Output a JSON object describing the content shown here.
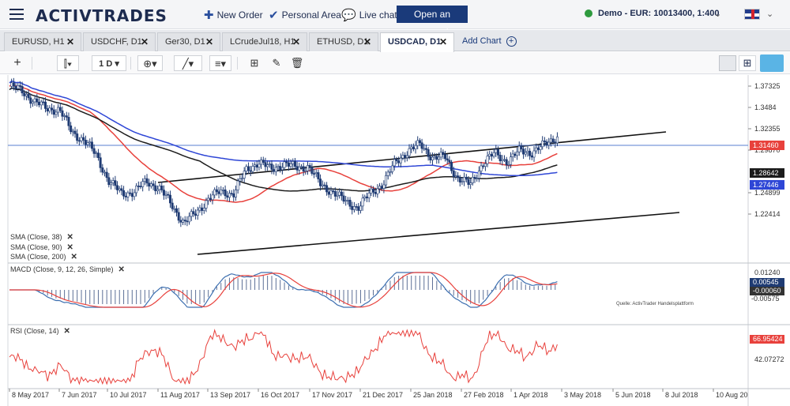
{
  "header": {
    "logo": "ACTIVTRADES",
    "new_order": "New Order",
    "personal_area": "Personal Area",
    "live_chat": "Live chat",
    "open_account": "Open an account",
    "account": "Demo - EUR: 10013400, 1:400"
  },
  "tabs": [
    {
      "label": "EURUSD, H1",
      "close": "✕"
    },
    {
      "label": "USDCHF, D1",
      "close": "✕"
    },
    {
      "label": "Ger30, D1",
      "close": "✕"
    },
    {
      "label": "LCrudeJul18, H1",
      "close": "✕"
    },
    {
      "label": "ETHUSD, D1",
      "close": "✕"
    },
    {
      "label": "USDCAD, D1",
      "close": "✕"
    }
  ],
  "add_chart": "Add Chart",
  "toolbar": {
    "period": "1 D"
  },
  "colors": {
    "sma38": "#e8413c",
    "sma90": "#1c1c1c",
    "sma200": "#2e46d6",
    "candle": "#1f3b73",
    "macd": "#3d6fb0",
    "signal": "#e8413c",
    "rsi": "#e8413c"
  },
  "legend": {
    "sma38": "SMA (Close, 38)",
    "sma90": "SMA (Close, 90)",
    "sma200": "SMA (Close, 200)",
    "macd": "MACD (Close, 9, 12, 26, Simple)",
    "rsi": "RSI (Close, 14)",
    "close": "✕",
    "source": "Quelle: ActivTrader Handelsplattform"
  },
  "chart_data": {
    "type": "candlestick",
    "symbol": "USDCAD, D1",
    "price_axis": [
      1.37325,
      1.3484,
      1.32355,
      1.2987,
      1.24899,
      1.22414
    ],
    "price_tags": [
      {
        "value": "1.31460",
        "color": "#e8413c"
      },
      {
        "value": "1.28642",
        "color": "#1c1c1c"
      },
      {
        "value": "1.27446",
        "color": "#2e46d6"
      }
    ],
    "horizontal_level": 1.3146,
    "macd_axis": [
      "0.01240",
      "-0.00575"
    ],
    "macd_tags": [
      {
        "value": "0.00545",
        "color": "#1f3b73"
      },
      {
        "value": "-0.00060",
        "color": "#ffffff"
      }
    ],
    "rsi_axis": [
      "42.07272"
    ],
    "rsi_tags": [
      {
        "value": "66.95424",
        "color": "#e8413c"
      }
    ],
    "x_labels": [
      "8 May 2017",
      "7 Jun 2017",
      "10 Jul 2017",
      "11 Aug 2017",
      "13 Sep 2017",
      "16 Oct 2017",
      "17 Nov 2017",
      "21 Dec 2017",
      "25 Jan 2018",
      "27 Feb 2018",
      "1 Apr 2018",
      "3 May 2018",
      "5 Jun 2018",
      "8 Jul 2018",
      "10 Aug 20"
    ],
    "close_series": [
      {
        "x": 0.0,
        "y": 1.373
      },
      {
        "x": 0.02,
        "y": 1.368
      },
      {
        "x": 0.04,
        "y": 1.355
      },
      {
        "x": 0.06,
        "y": 1.347
      },
      {
        "x": 0.08,
        "y": 1.346
      },
      {
        "x": 0.1,
        "y": 1.32
      },
      {
        "x": 0.12,
        "y": 1.31
      },
      {
        "x": 0.14,
        "y": 1.292
      },
      {
        "x": 0.16,
        "y": 1.262
      },
      {
        "x": 0.18,
        "y": 1.248
      },
      {
        "x": 0.2,
        "y": 1.25
      },
      {
        "x": 0.22,
        "y": 1.262
      },
      {
        "x": 0.24,
        "y": 1.255
      },
      {
        "x": 0.26,
        "y": 1.235
      },
      {
        "x": 0.28,
        "y": 1.214
      },
      {
        "x": 0.3,
        "y": 1.225
      },
      {
        "x": 0.32,
        "y": 1.243
      },
      {
        "x": 0.34,
        "y": 1.25
      },
      {
        "x": 0.36,
        "y": 1.248
      },
      {
        "x": 0.38,
        "y": 1.275
      },
      {
        "x": 0.4,
        "y": 1.285
      },
      {
        "x": 0.42,
        "y": 1.276
      },
      {
        "x": 0.44,
        "y": 1.283
      },
      {
        "x": 0.46,
        "y": 1.278
      },
      {
        "x": 0.48,
        "y": 1.28
      },
      {
        "x": 0.5,
        "y": 1.258
      },
      {
        "x": 0.52,
        "y": 1.25
      },
      {
        "x": 0.54,
        "y": 1.238
      },
      {
        "x": 0.56,
        "y": 1.232
      },
      {
        "x": 0.58,
        "y": 1.248
      },
      {
        "x": 0.6,
        "y": 1.26
      },
      {
        "x": 0.62,
        "y": 1.284
      },
      {
        "x": 0.64,
        "y": 1.298
      },
      {
        "x": 0.66,
        "y": 1.305
      },
      {
        "x": 0.68,
        "y": 1.29
      },
      {
        "x": 0.7,
        "y": 1.29
      },
      {
        "x": 0.72,
        "y": 1.266
      },
      {
        "x": 0.74,
        "y": 1.258
      },
      {
        "x": 0.76,
        "y": 1.283
      },
      {
        "x": 0.78,
        "y": 1.295
      },
      {
        "x": 0.8,
        "y": 1.285
      },
      {
        "x": 0.82,
        "y": 1.298
      },
      {
        "x": 0.84,
        "y": 1.296
      },
      {
        "x": 0.86,
        "y": 1.305
      },
      {
        "x": 0.88,
        "y": 1.315
      }
    ]
  }
}
